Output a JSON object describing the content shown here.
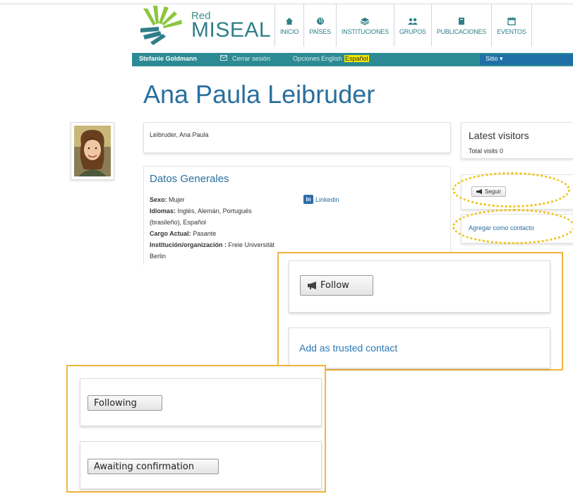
{
  "header": {
    "logo_small": "Red",
    "logo_big": "MISEAL",
    "nav": [
      {
        "label": "INICIO",
        "icon": "home-icon"
      },
      {
        "label": "PAÍSES",
        "icon": "globe-icon"
      },
      {
        "label": "INSTITUCIONES",
        "icon": "layers-icon"
      },
      {
        "label": "GRUPOS",
        "icon": "group-icon"
      },
      {
        "label": "PUBLICACIONES",
        "icon": "book-icon"
      },
      {
        "label": "EVENTOS",
        "icon": "calendar-icon"
      }
    ]
  },
  "topbar": {
    "user": "Stefanie Goldmann",
    "logout": "Cerrar sesión",
    "options": "Opciones",
    "lang_en": "English",
    "lang_es": "Español",
    "site_menu": "Sitio ▾"
  },
  "profile": {
    "name": "Ana Paula Leibruder",
    "fullname_line": "Leibruder, Ana Paula",
    "section_title": "Datos Generales",
    "sex_label": "Sexo:",
    "sex_value": "Mujer",
    "lang_label": "Idiomas:",
    "lang_value_1": "Inglés, Alemán, Portugués",
    "lang_value_2": "(brasileño), Español",
    "position_label": "Cargo Actual:",
    "position_value": "Pasante",
    "inst_label": "Institución/organización :",
    "inst_value": "Freie Universität",
    "inst_value_cont": "Berlin",
    "linkedin": "Linkedin"
  },
  "sidebar": {
    "visitors_title": "Latest visitors",
    "total_visits": "Total visits 0",
    "follow_small": "Seguir",
    "add_contact_small": "Agregar como contacto"
  },
  "overlay_en": {
    "follow": "Follow",
    "add_trusted": "Add as trusted contact"
  },
  "overlay_states": {
    "following": "Following",
    "awaiting": "Awaiting confirmation"
  },
  "colors": {
    "teal_bar": "#2c8a94",
    "highlight": "#f2b43a",
    "link": "#2a6f9e"
  }
}
